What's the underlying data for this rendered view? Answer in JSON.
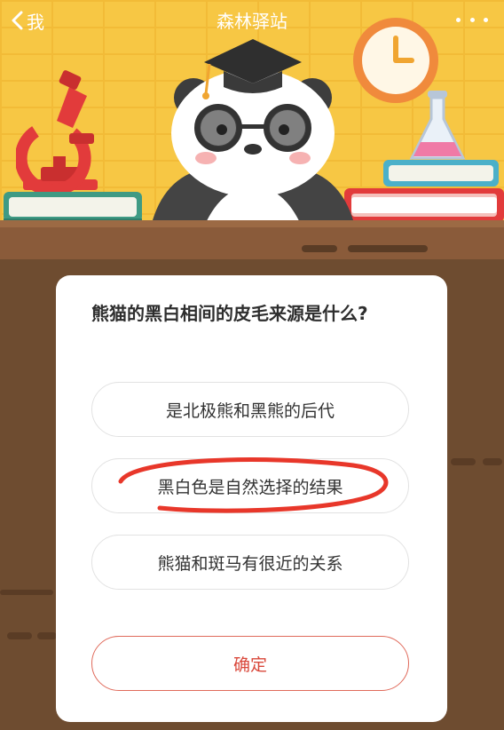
{
  "header": {
    "back_label": "我",
    "title": "森林驿站"
  },
  "quiz": {
    "question": "熊猫的黑白相间的皮毛来源是什么?",
    "options": [
      {
        "label": "是北极熊和黑熊的后代"
      },
      {
        "label": "黑白色是自然选择的结果"
      },
      {
        "label": "熊猫和斑马有很近的关系"
      }
    ],
    "confirm_label": "确定",
    "annotated_option_index": 1
  },
  "icons": {
    "back": "chevron-left-icon",
    "more": "more-dots-icon",
    "microscope": "microscope-icon",
    "clock": "clock-icon",
    "flask": "flask-icon",
    "panda": "panda-mascot-icon",
    "books": "book-stack-icon"
  },
  "colors": {
    "wall": "#f7c744",
    "desk": "#6e4c30",
    "confirm_text": "#d9473a",
    "annotation_stroke": "#e8372a"
  }
}
